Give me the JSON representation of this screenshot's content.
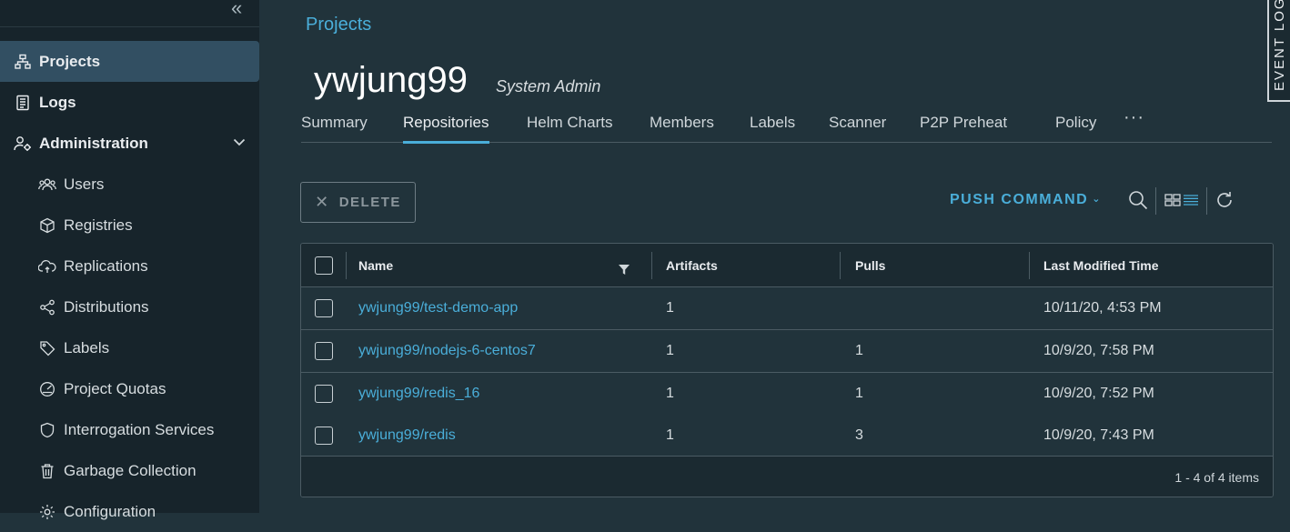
{
  "sidebar": {
    "collapse_glyph": "«",
    "items": [
      {
        "label": "Projects",
        "icon": "projects-icon"
      },
      {
        "label": "Logs",
        "icon": "logs-icon"
      },
      {
        "label": "Administration",
        "icon": "administration-icon"
      },
      {
        "label": "Users",
        "icon": "users-icon"
      },
      {
        "label": "Registries",
        "icon": "registries-icon"
      },
      {
        "label": "Replications",
        "icon": "replications-icon"
      },
      {
        "label": "Distributions",
        "icon": "distributions-icon"
      },
      {
        "label": "Labels",
        "icon": "labels-icon"
      },
      {
        "label": "Project Quotas",
        "icon": "project-quotas-icon"
      },
      {
        "label": "Interrogation Services",
        "icon": "interrogation-services-icon"
      },
      {
        "label": "Garbage Collection",
        "icon": "garbage-collection-icon"
      },
      {
        "label": "Configuration",
        "icon": "configuration-icon"
      }
    ]
  },
  "header": {
    "breadcrumb": "Projects",
    "title": "ywjung99",
    "role": "System Admin"
  },
  "tabs": [
    {
      "label": "Summary"
    },
    {
      "label": "Repositories",
      "active": true
    },
    {
      "label": "Helm Charts"
    },
    {
      "label": "Members"
    },
    {
      "label": "Labels"
    },
    {
      "label": "Scanner"
    },
    {
      "label": "P2P Preheat"
    },
    {
      "label": "Policy"
    }
  ],
  "tabs_more": "···",
  "toolbar": {
    "delete_label": "DELETE",
    "push_command_label": "PUSH COMMAND"
  },
  "table": {
    "columns": [
      "Name",
      "Artifacts",
      "Pulls",
      "Last Modified Time"
    ],
    "rows": [
      {
        "name": "ywjung99/test-demo-app",
        "artifacts": "1",
        "pulls": "",
        "modified": "10/11/20, 4:53 PM"
      },
      {
        "name": "ywjung99/nodejs-6-centos7",
        "artifacts": "1",
        "pulls": "1",
        "modified": "10/9/20, 7:58 PM"
      },
      {
        "name": "ywjung99/redis_16",
        "artifacts": "1",
        "pulls": "1",
        "modified": "10/9/20, 7:52 PM"
      },
      {
        "name": "ywjung99/redis",
        "artifacts": "1",
        "pulls": "3",
        "modified": "10/9/20, 7:43 PM"
      }
    ],
    "footer": "1 - 4 of 4 items"
  },
  "event_log": "EVENT LOG",
  "colors": {
    "accent": "#4aaed9",
    "sidebar_bg": "#17242b",
    "main_bg": "#21333b",
    "active_nav": "#324f62"
  }
}
